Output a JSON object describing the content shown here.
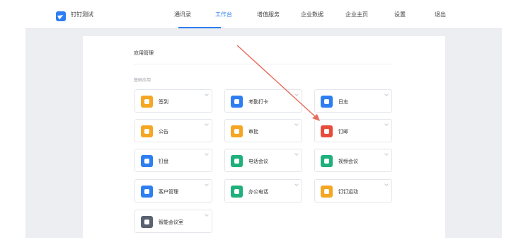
{
  "app": {
    "name": "钉钉测试"
  },
  "nav": {
    "items": [
      {
        "label": "通讯录",
        "active": false
      },
      {
        "label": "工作台",
        "active": true
      },
      {
        "label": "增值服务",
        "active": false
      },
      {
        "label": "企业数据",
        "active": false
      },
      {
        "label": "企业主页",
        "active": false
      },
      {
        "label": "设置",
        "active": false
      },
      {
        "label": "退出",
        "active": false
      }
    ]
  },
  "panel": {
    "title": "应用管理",
    "section_title": "基础应用"
  },
  "apps": [
    {
      "label": "签到",
      "icon": "pin-icon",
      "color": "#f5a623"
    },
    {
      "label": "考勤打卡",
      "icon": "location-icon",
      "color": "#2e7ef2"
    },
    {
      "label": "日志",
      "icon": "log-icon",
      "color": "#2e7ef2"
    },
    {
      "label": "公告",
      "icon": "megaphone-icon",
      "color": "#f5a623"
    },
    {
      "label": "审批",
      "icon": "stamp-icon",
      "color": "#f5a623"
    },
    {
      "label": "钉邮",
      "icon": "mail-icon",
      "color": "#e84c3d"
    },
    {
      "label": "钉盘",
      "icon": "cloud-icon",
      "color": "#2e7ef2"
    },
    {
      "label": "电话会议",
      "icon": "phone-conference-icon",
      "color": "#1fb07b"
    },
    {
      "label": "视频会议",
      "icon": "phone-icon",
      "color": "#1fb07b"
    },
    {
      "label": "客户管理",
      "icon": "customer-icon",
      "color": "#2e7ef2"
    },
    {
      "label": "办公电话",
      "icon": "telephone-icon",
      "color": "#1fb07b"
    },
    {
      "label": "钉钉运动",
      "icon": "run-icon",
      "color": "#f5a623"
    },
    {
      "label": "智能会议室",
      "icon": "monitor-icon",
      "color": "#5a6270"
    }
  ],
  "colors": {
    "accent": "#2e7ef2",
    "arrow": "#e86b5c"
  }
}
